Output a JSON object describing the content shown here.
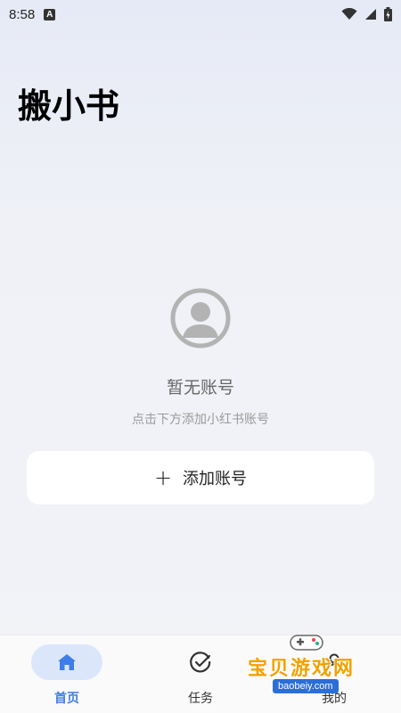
{
  "status_bar": {
    "time": "8:58",
    "notification_glyph": "A",
    "icons": [
      "wifi-icon",
      "signal-icon",
      "battery-icon"
    ]
  },
  "header": {
    "title": "搬小书"
  },
  "empty_state": {
    "icon": "avatar-placeholder-icon",
    "title": "暂无账号",
    "subtitle": "点击下方添加小红书账号"
  },
  "add_account": {
    "icon": "plus-icon",
    "label": "添加账号"
  },
  "tabbar": {
    "tabs": [
      {
        "label": "首页",
        "icon": "home-icon",
        "active": true
      },
      {
        "label": "任务",
        "icon": "check-circle-icon",
        "active": false
      },
      {
        "label": "我的",
        "icon": "user-icon",
        "active": false
      }
    ]
  },
  "watermark": {
    "text": "宝贝游戏网",
    "url": "baobeiy.com"
  },
  "colors": {
    "accent": "#3f7de8",
    "active_tab_bg": "#dce6fb",
    "muted_text": "#9a9a9a"
  }
}
